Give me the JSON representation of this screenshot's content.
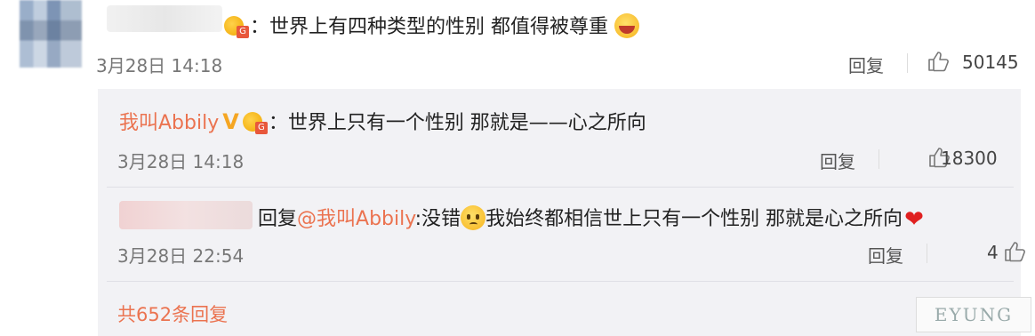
{
  "top_comment": {
    "text": "：世界上有四种类型的性别 都值得被尊重",
    "time": "3月28日 14:18",
    "reply_label": "回复",
    "likes": "50145"
  },
  "reply1": {
    "user": "我叫Abbily",
    "text": "：世界上只有一个性别 那就是——心之所向",
    "time": "3月28日 14:18",
    "reply_label": "回复",
    "likes": "18300"
  },
  "reply2": {
    "prefix": "回复",
    "mention": "@我叫Abbily",
    "text_a": ":没错",
    "text_b": "我始终都相信世上只有一个性别 那就是心之所向",
    "time": "3月28日 22:54",
    "reply_label": "回复",
    "likes": "4"
  },
  "footer": {
    "more_replies": "共652条回复"
  },
  "watermark": "EYUNG",
  "colors": {
    "link": "#eb7350",
    "panel_bg": "#f2f2f5"
  },
  "icons": [
    "thumbs-up-icon",
    "vip-crown-badge-icon",
    "verified-v-icon",
    "worried-emoji-icon",
    "crying-emoji-icon",
    "heart-icon"
  ]
}
